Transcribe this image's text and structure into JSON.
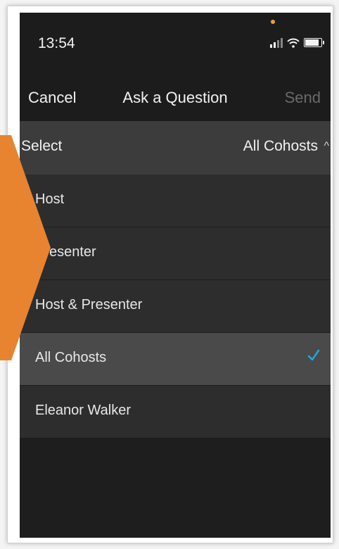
{
  "status_bar": {
    "time": "13:54"
  },
  "nav": {
    "cancel_label": "Cancel",
    "title": "Ask a Question",
    "send_label": "Send"
  },
  "select": {
    "label": "Select",
    "value": "All Cohosts"
  },
  "options": [
    {
      "label": "Host",
      "selected": false
    },
    {
      "label": "Presenter",
      "selected": false
    },
    {
      "label": "Host & Presenter",
      "selected": false
    },
    {
      "label": "All Cohosts",
      "selected": true
    },
    {
      "label": "Eleanor Walker",
      "selected": false
    }
  ],
  "colors": {
    "accent_check": "#2aa3dc",
    "arrow": "#e8832f",
    "selected_row": "#4a4a4a"
  },
  "icons": {
    "check": "check-icon",
    "chevron": "chevron-up-icon",
    "signal": "signal-icon",
    "wifi": "wifi-icon",
    "battery": "battery-icon"
  }
}
